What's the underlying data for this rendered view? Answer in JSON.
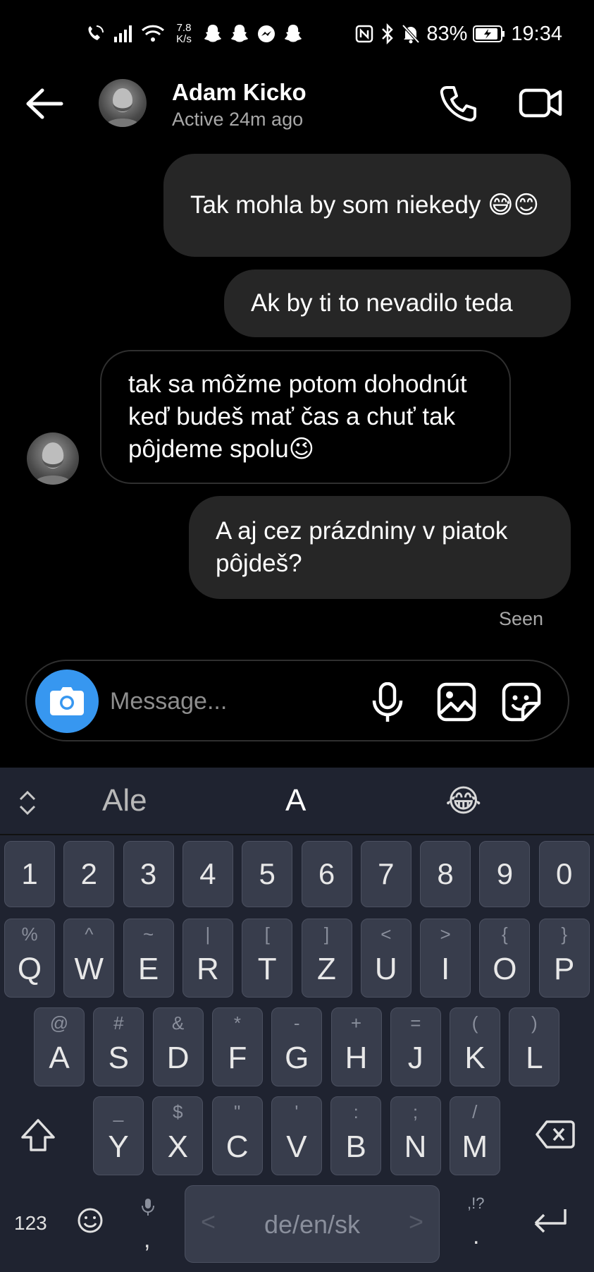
{
  "status_bar": {
    "net_speed_value": "7.8",
    "net_speed_unit": "K/s",
    "battery": "83%",
    "time": "19:34",
    "icons": [
      "wifi-calling-icon",
      "signal-icon",
      "wifi-icon",
      "snapchat-icon",
      "snapchat-icon",
      "messenger-icon",
      "snapchat-icon",
      "nfc-icon",
      "bluetooth-icon",
      "mute-icon",
      "battery-charging-icon"
    ]
  },
  "header": {
    "name": "Adam Kicko",
    "status": "Active 24m ago"
  },
  "messages": [
    {
      "side": "out",
      "text": "Tak mohla by som niekedy 😅😊"
    },
    {
      "side": "out",
      "text": "Ak by ti to nevadilo teda"
    },
    {
      "side": "in",
      "text": "tak sa môžme potom dohodnút keď budeš mať čas a chuť tak pôjdeme spolu😉"
    },
    {
      "side": "out",
      "text": "A aj cez prázdniny v piatok pôjdeš?"
    }
  ],
  "seen_label": "Seen",
  "composer": {
    "placeholder": "Message..."
  },
  "keyboard": {
    "suggestions": [
      "Ale",
      "A",
      "😂"
    ],
    "number_row": [
      "1",
      "2",
      "3",
      "4",
      "5",
      "6",
      "7",
      "8",
      "9",
      "0"
    ],
    "row1": [
      {
        "k": "Q",
        "a": "%"
      },
      {
        "k": "W",
        "a": "^"
      },
      {
        "k": "E",
        "a": "~"
      },
      {
        "k": "R",
        "a": "|"
      },
      {
        "k": "T",
        "a": "["
      },
      {
        "k": "Z",
        "a": "]"
      },
      {
        "k": "U",
        "a": "<"
      },
      {
        "k": "I",
        "a": ">"
      },
      {
        "k": "O",
        "a": "{"
      },
      {
        "k": "P",
        "a": "}"
      }
    ],
    "row2": [
      {
        "k": "A",
        "a": "@"
      },
      {
        "k": "S",
        "a": "#"
      },
      {
        "k": "D",
        "a": "&"
      },
      {
        "k": "F",
        "a": "*"
      },
      {
        "k": "G",
        "a": "-"
      },
      {
        "k": "H",
        "a": "+"
      },
      {
        "k": "J",
        "a": "="
      },
      {
        "k": "K",
        "a": "("
      },
      {
        "k": "L",
        "a": ")"
      }
    ],
    "row3": [
      {
        "k": "Y",
        "a": "_"
      },
      {
        "k": "X",
        "a": "$"
      },
      {
        "k": "C",
        "a": "\""
      },
      {
        "k": "V",
        "a": "'"
      },
      {
        "k": "B",
        "a": ":"
      },
      {
        "k": "N",
        "a": ";"
      },
      {
        "k": "M",
        "a": "/"
      }
    ],
    "numbers_key": "123",
    "comma": ",",
    "space_label": "de/en/sk",
    "space_left_arrow": "<",
    "space_right_arrow": ">",
    "period_alt": ",!?",
    "period": "."
  },
  "colors": {
    "background": "#000000",
    "outgoing_bubble": "#262626",
    "camera_button": "#3797f0",
    "keyboard_bg": "#1f2330",
    "key_bg": "#383d4c"
  }
}
